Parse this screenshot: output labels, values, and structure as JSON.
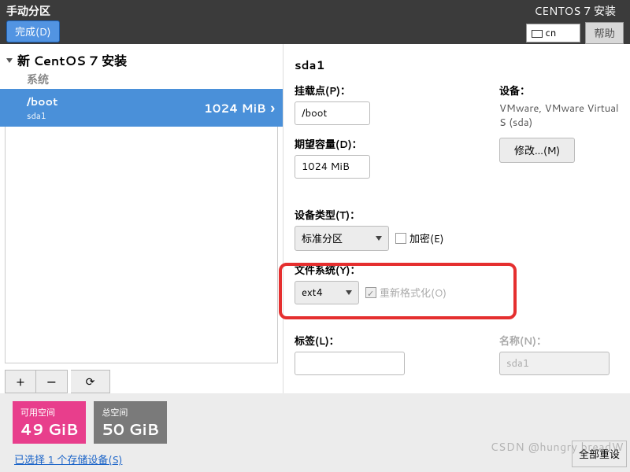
{
  "header": {
    "title": "手动分区",
    "done_btn": "完成(D)",
    "installer_title": "CENTOS 7 安装",
    "lang": "cn",
    "help_btn": "帮助"
  },
  "tree": {
    "root_label": "新 CentOS 7 安装",
    "section_label": "系统",
    "selected": {
      "mount": "/boot",
      "device": "sda1",
      "size": "1024 MiB"
    },
    "buttons": {
      "add": "+",
      "remove": "−",
      "refresh": "⟳"
    }
  },
  "detail": {
    "partition_name": "sda1",
    "mountpoint": {
      "label": "挂载点(P)：",
      "value": "/boot"
    },
    "desired": {
      "label": "期望容量(D)：",
      "value": "1024 MiB"
    },
    "device_type": {
      "label": "设备类型(T)：",
      "value": "标准分区",
      "encrypt_label": "加密(E)"
    },
    "filesystem": {
      "label": "文件系统(Y)：",
      "value": "ext4",
      "reformat_label": "重新格式化(O)"
    },
    "labelfield": {
      "label": "标签(L)：",
      "value": ""
    },
    "namefield": {
      "label": "名称(N)：",
      "value": "sda1"
    },
    "devices": {
      "label": "设备：",
      "text": "VMware, VMware Virtual S (sda)",
      "modify_btn": "修改...(M)"
    }
  },
  "bottom": {
    "available": {
      "label": "可用空间",
      "value": "49 GiB"
    },
    "total": {
      "label": "总空间",
      "value": "50 GiB"
    },
    "storage_link": "已选择 1 个存储设备(S)",
    "reset_btn": "全部重设"
  },
  "watermark": "CSDN @hungry breadW"
}
